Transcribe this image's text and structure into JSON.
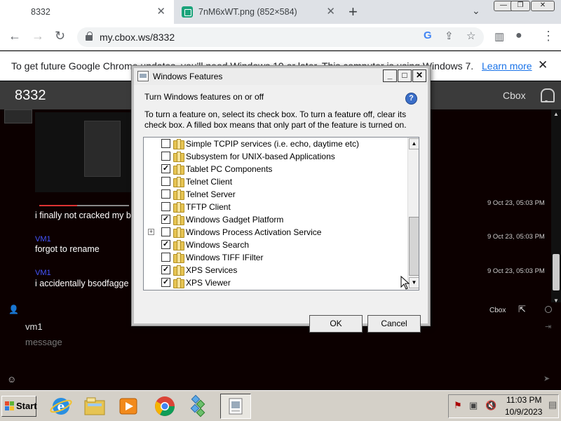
{
  "browser": {
    "tabs": [
      {
        "title": "8332",
        "active": true
      },
      {
        "title": "7nM6xWT.png (852×584)",
        "active": false
      }
    ],
    "url": "my.cbox.ws/8332",
    "infobar": {
      "text": "To get future Google Chrome updates, you'll need Windows 10 or later. This computer is using Windows 7.",
      "learn_more": "Learn more"
    },
    "icons": {
      "newtab": "+",
      "close": "✕",
      "back": "←",
      "forward": "→",
      "reload": "↻"
    }
  },
  "cbox": {
    "room_title": "8332",
    "brand": "Cbox",
    "messages": [
      {
        "user": "",
        "text": "i finally not cracked my b",
        "time": "9 Oct 23, 05:03 PM"
      },
      {
        "user": "VM1",
        "text": "forgot to rename",
        "time": "9 Oct 23, 05:03 PM"
      },
      {
        "user": "VM1",
        "text": "i accidentally bsodfagge",
        "time": "9 Oct 23, 05:03 PM"
      }
    ],
    "footer": {
      "cbox_link": "Cbox",
      "name_value": "vm1",
      "message_placeholder": "message"
    }
  },
  "dialog": {
    "title": "Windows Features",
    "heading": "Turn Windows features on or off",
    "description": "To turn a feature on, select its check box. To turn a feature off, clear its check box. A filled box means that only part of the feature is turned on.",
    "features": [
      {
        "label": "Simple TCPIP services (i.e. echo, daytime etc)",
        "checked": false,
        "expandable": false
      },
      {
        "label": "Subsystem for UNIX-based Applications",
        "checked": false,
        "expandable": false
      },
      {
        "label": "Tablet PC Components",
        "checked": true,
        "expandable": false
      },
      {
        "label": "Telnet Client",
        "checked": false,
        "expandable": false
      },
      {
        "label": "Telnet Server",
        "checked": false,
        "expandable": false
      },
      {
        "label": "TFTP Client",
        "checked": false,
        "expandable": false
      },
      {
        "label": "Windows Gadget Platform",
        "checked": true,
        "expandable": false
      },
      {
        "label": "Windows Process Activation Service",
        "checked": false,
        "expandable": true
      },
      {
        "label": "Windows Search",
        "checked": true,
        "expandable": false
      },
      {
        "label": "Windows TIFF IFilter",
        "checked": false,
        "expandable": false
      },
      {
        "label": "XPS Services",
        "checked": true,
        "expandable": false
      },
      {
        "label": "XPS Viewer",
        "checked": true,
        "expandable": false
      }
    ],
    "ok_label": "OK",
    "cancel_label": "Cancel"
  },
  "taskbar": {
    "start_label": "Start",
    "clock_time": "11:03 PM",
    "clock_date": "10/9/2023",
    "apps": [
      "internet-explorer-icon",
      "windows-explorer-icon",
      "media-player-icon",
      "chrome-icon",
      "game-icon",
      "windows-features-icon"
    ]
  }
}
